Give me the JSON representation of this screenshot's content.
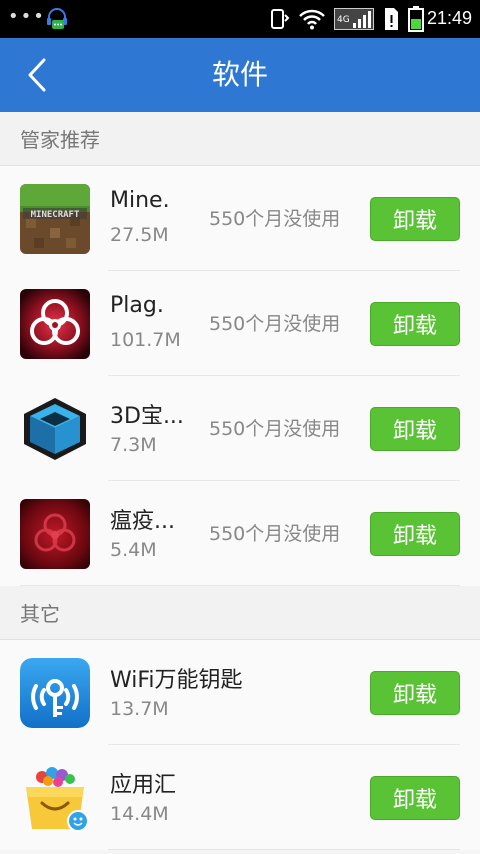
{
  "status_bar": {
    "time": "21:49",
    "network_label": "4G",
    "icons": [
      "overflow-dots",
      "headset-chat-icon",
      "vibrate-icon",
      "wifi-icon",
      "signal-icon",
      "sim-alert-icon",
      "battery-icon"
    ]
  },
  "header": {
    "title": "软件",
    "back_icon": "chevron-left-icon",
    "background": "#2e78d3"
  },
  "sections": [
    {
      "title": "管家推荐",
      "apps": [
        {
          "name": "Mine.",
          "size": "27.5M",
          "unused": "550个月没使用",
          "action": "卸载",
          "icon": "minecraft-icon"
        },
        {
          "name": "Plag.",
          "size": "101.7M",
          "unused": "550个月没使用",
          "action": "卸载",
          "icon": "biohazard-icon"
        },
        {
          "name": "3D宝...",
          "size": "7.3M",
          "unused": "550个月没使用",
          "action": "卸载",
          "icon": "cube-icon"
        },
        {
          "name": "瘟疫...",
          "size": "5.4M",
          "unused": "550个月没使用",
          "action": "卸载",
          "icon": "biohazard-dark-icon"
        }
      ]
    },
    {
      "title": "其它",
      "apps": [
        {
          "name": "WiFi万能钥匙",
          "size": "13.7M",
          "action": "卸载",
          "icon": "wifi-key-icon"
        },
        {
          "name": "应用汇",
          "size": "14.4M",
          "action": "卸载",
          "icon": "appchina-icon"
        }
      ]
    }
  ],
  "colors": {
    "accent": "#2e78d3",
    "button_green": "#5ac235"
  }
}
